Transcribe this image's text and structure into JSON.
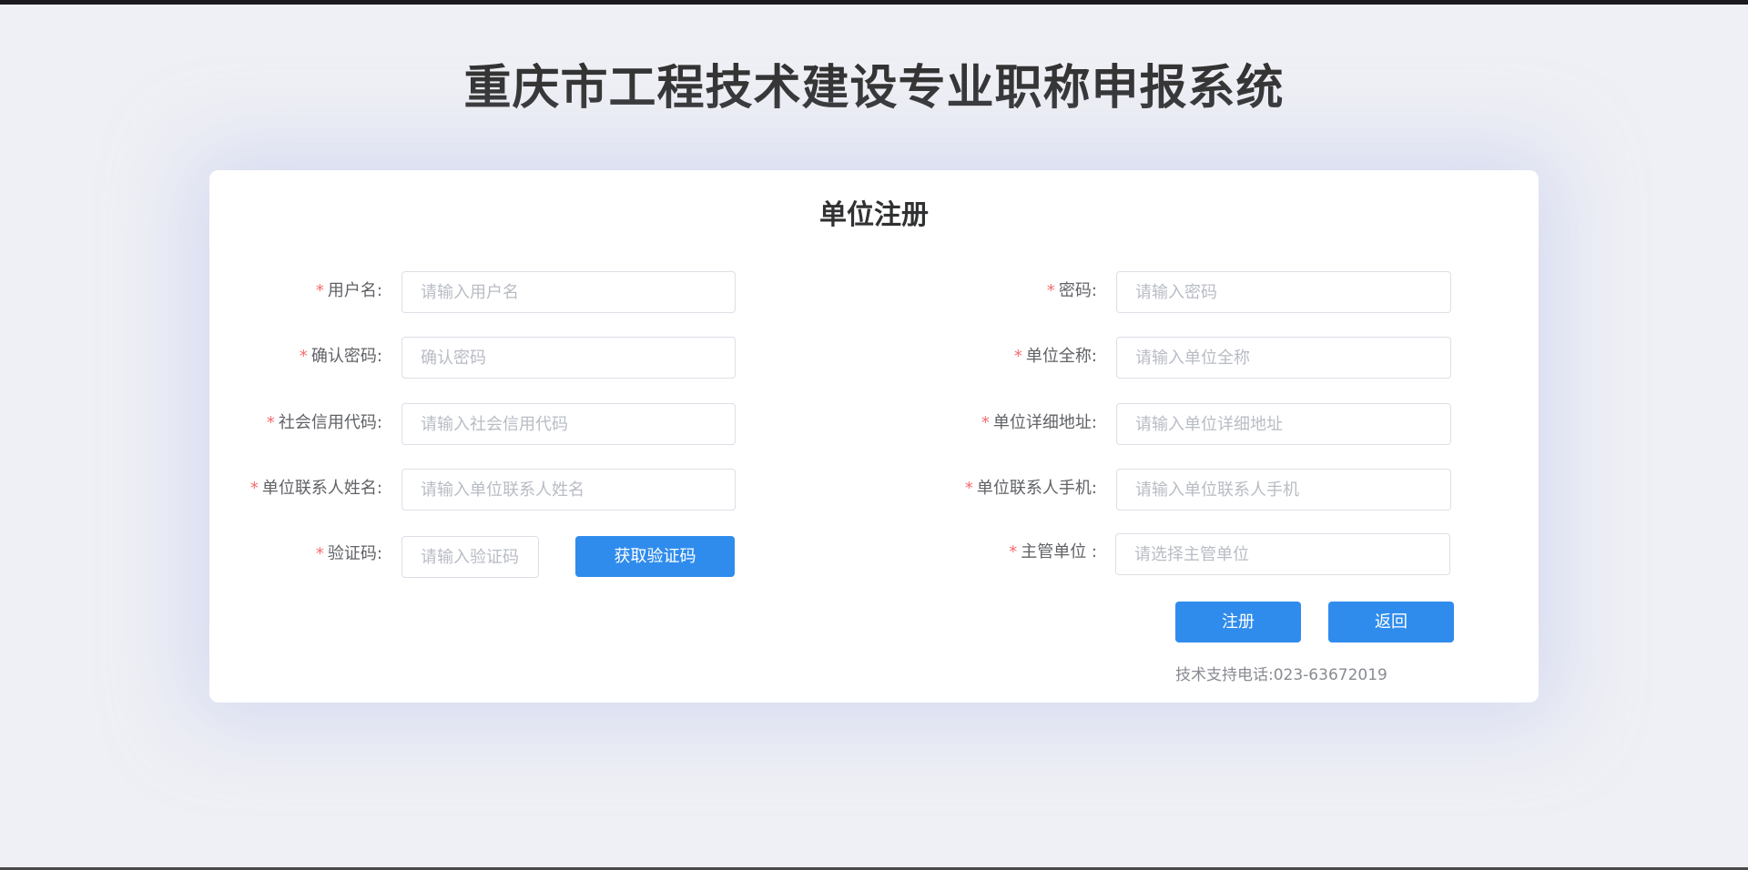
{
  "app": {
    "title": "重庆市工程技术建设专业职称申报系统"
  },
  "form": {
    "title": "单位注册",
    "required_mark": "*",
    "fields": {
      "username": {
        "label": "用户名:",
        "placeholder": "请输入用户名",
        "value": ""
      },
      "password": {
        "label": "密码:",
        "placeholder": "请输入密码",
        "value": ""
      },
      "confirm_password": {
        "label": "确认密码:",
        "placeholder": "确认密码",
        "value": ""
      },
      "org_full_name": {
        "label": "单位全称:",
        "placeholder": "请输入单位全称",
        "value": ""
      },
      "credit_code": {
        "label": "社会信用代码:",
        "placeholder": "请输入社会信用代码",
        "value": ""
      },
      "org_address": {
        "label": "单位详细地址:",
        "placeholder": "请输入单位详细地址",
        "value": ""
      },
      "contact_name": {
        "label": "单位联系人姓名:",
        "placeholder": "请输入单位联系人姓名",
        "value": ""
      },
      "contact_phone": {
        "label": "单位联系人手机:",
        "placeholder": "请输入单位联系人手机",
        "value": ""
      },
      "verify_code": {
        "label": "验证码:",
        "placeholder": "请输入验证码",
        "value": ""
      },
      "supervisor": {
        "label": "主管单位 :",
        "placeholder": "请选择主管单位",
        "value": ""
      }
    },
    "buttons": {
      "get_code": "获取验证码",
      "register": "注册",
      "back": "返回"
    },
    "support_text": "技术支持电话:023-63672019"
  },
  "colors": {
    "page_background": "#eff0f5",
    "card_background": "#ffffff",
    "primary": "#2f8ced",
    "required": "#f56c6c",
    "title_text": "#333333"
  }
}
